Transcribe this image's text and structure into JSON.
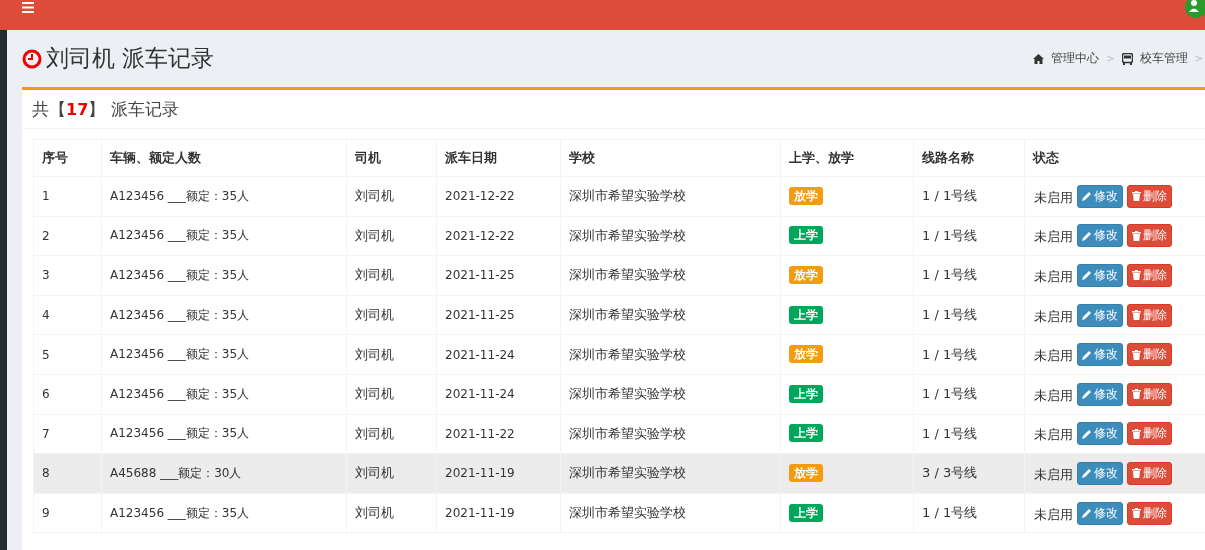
{
  "page_title": "刘司机 派车记录",
  "breadcrumb": [
    {
      "label": "管理中心",
      "separator": ">"
    },
    {
      "label": "校车管理",
      "separator": ">"
    }
  ],
  "summary": {
    "prefix": "共【",
    "count": "17",
    "suffix": "】 派车记录"
  },
  "table": {
    "columns": [
      "序号",
      "车辆、额定人数",
      "司机",
      "派车日期",
      "学校",
      "上学、放学",
      "线路名称",
      "状态"
    ],
    "rows": [
      {
        "no": "1",
        "vehicle": "A123456 ___额定：35人",
        "driver": "刘司机",
        "date": "2021-12-22",
        "school": "深圳市希望实验学校",
        "trip": {
          "label": "放学",
          "kind": "leave"
        },
        "route": "1 / 1号线",
        "status": "未启用",
        "edit": "修改",
        "delete": "删除",
        "selected": false
      },
      {
        "no": "2",
        "vehicle": "A123456 ___额定：35人",
        "driver": "刘司机",
        "date": "2021-12-22",
        "school": "深圳市希望实验学校",
        "trip": {
          "label": "上学",
          "kind": "arrive"
        },
        "route": "1 / 1号线",
        "status": "未启用",
        "edit": "修改",
        "delete": "删除",
        "selected": false
      },
      {
        "no": "3",
        "vehicle": "A123456 ___额定：35人",
        "driver": "刘司机",
        "date": "2021-11-25",
        "school": "深圳市希望实验学校",
        "trip": {
          "label": "放学",
          "kind": "leave"
        },
        "route": "1 / 1号线",
        "status": "未启用",
        "edit": "修改",
        "delete": "删除",
        "selected": false
      },
      {
        "no": "4",
        "vehicle": "A123456 ___额定：35人",
        "driver": "刘司机",
        "date": "2021-11-25",
        "school": "深圳市希望实验学校",
        "trip": {
          "label": "上学",
          "kind": "arrive"
        },
        "route": "1 / 1号线",
        "status": "未启用",
        "edit": "修改",
        "delete": "删除",
        "selected": false
      },
      {
        "no": "5",
        "vehicle": "A123456 ___额定：35人",
        "driver": "刘司机",
        "date": "2021-11-24",
        "school": "深圳市希望实验学校",
        "trip": {
          "label": "放学",
          "kind": "leave"
        },
        "route": "1 / 1号线",
        "status": "未启用",
        "edit": "修改",
        "delete": "删除",
        "selected": false
      },
      {
        "no": "6",
        "vehicle": "A123456 ___额定：35人",
        "driver": "刘司机",
        "date": "2021-11-24",
        "school": "深圳市希望实验学校",
        "trip": {
          "label": "上学",
          "kind": "arrive"
        },
        "route": "1 / 1号线",
        "status": "未启用",
        "edit": "修改",
        "delete": "删除",
        "selected": false
      },
      {
        "no": "7",
        "vehicle": "A123456 ___额定：35人",
        "driver": "刘司机",
        "date": "2021-11-22",
        "school": "深圳市希望实验学校",
        "trip": {
          "label": "上学",
          "kind": "arrive"
        },
        "route": "1 / 1号线",
        "status": "未启用",
        "edit": "修改",
        "delete": "删除",
        "selected": false
      },
      {
        "no": "8",
        "vehicle": "A45688 ___额定：30人",
        "driver": "刘司机",
        "date": "2021-11-19",
        "school": "深圳市希望实验学校",
        "trip": {
          "label": "放学",
          "kind": "leave"
        },
        "route": "3 / 3号线",
        "status": "未启用",
        "edit": "修改",
        "delete": "删除",
        "selected": true
      },
      {
        "no": "9",
        "vehicle": "A123456 ___额定：35人",
        "driver": "刘司机",
        "date": "2021-11-19",
        "school": "深圳市希望实验学校",
        "trip": {
          "label": "上学",
          "kind": "arrive"
        },
        "route": "1 / 1号线",
        "status": "未启用",
        "edit": "修改",
        "delete": "删除",
        "selected": false
      }
    ]
  }
}
